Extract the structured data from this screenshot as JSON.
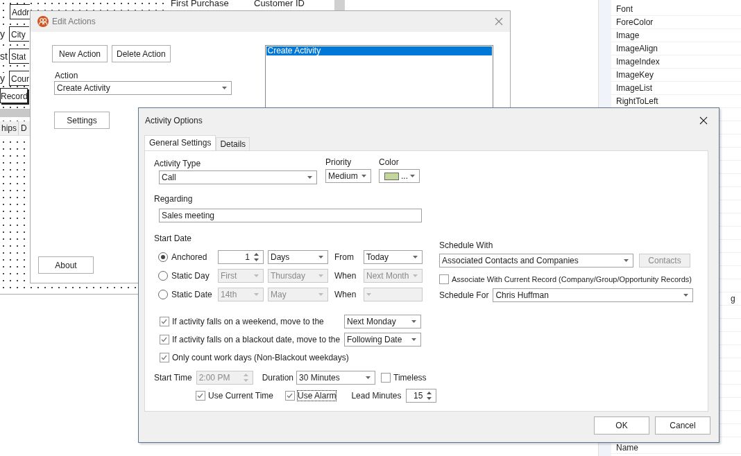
{
  "designer": {
    "fields": [
      {
        "value": "Addr"
      },
      {
        "label": "y",
        "value": "City"
      },
      {
        "label": "st",
        "value": "Stat"
      },
      {
        "label": "y",
        "value": "Cour"
      }
    ],
    "button": "Record",
    "tabs": [
      "hips",
      "D"
    ]
  },
  "grid_header": [
    "First Purchase",
    "Customer ID"
  ],
  "property_grid": {
    "items": [
      "Font",
      "ForeColor",
      "Image",
      "ImageAlign",
      "ImageIndex",
      "ImageKey",
      "ImageList",
      "RightToLeft"
    ],
    "partial_value": "g",
    "bottom_item": "Name"
  },
  "edit_actions": {
    "title": "Edit Actions",
    "buttons": [
      "New Action",
      "Delete Action"
    ],
    "action_label": "Action",
    "action_value": "Create Activity",
    "list": [
      {
        "label": "Create Activity",
        "selected": true
      }
    ],
    "settings_button": "Settings",
    "about_button": "About"
  },
  "activity_options": {
    "title": "Activity Options",
    "tabs": [
      {
        "label": "General Settings",
        "selected": true
      },
      {
        "label": "Details",
        "selected": false
      }
    ],
    "activity_type": {
      "label": "Activity Type",
      "value": "Call"
    },
    "priority": {
      "label": "Priority",
      "value": "Medium"
    },
    "color": {
      "label": "Color",
      "color": "#c4d79b",
      "text": "..."
    },
    "regarding": {
      "label": "Regarding",
      "value": "Sales meeting"
    },
    "start_date": {
      "label": "Start Date",
      "options": [
        {
          "label": "Anchored",
          "selected": true,
          "first": {
            "kind": "spinner",
            "value": "1"
          },
          "second": "Days",
          "link_label": "From",
          "link_value": "Today"
        },
        {
          "label": "Static Day",
          "selected": false,
          "first": {
            "kind": "combo",
            "value": "First"
          },
          "second": "Thursday",
          "link_label": "When",
          "link_value": "Next Month"
        },
        {
          "label": "Static Date",
          "selected": false,
          "first": {
            "kind": "combo",
            "value": "14th"
          },
          "second": "May",
          "link_label": "When"
        }
      ]
    },
    "rules": [
      {
        "label": "If activity falls on a weekend, move to the",
        "checked": true,
        "value": "Next Monday"
      },
      {
        "label": "If activity falls on a blackout date, move to the",
        "checked": true,
        "value": "Following Date"
      },
      {
        "label": "Only count work days (Non-Blackout weekdays)",
        "checked": true
      }
    ],
    "start_time": {
      "label": "Start Time",
      "value": "2:00 PM"
    },
    "duration": {
      "label": "Duration",
      "value": "30 Minutes"
    },
    "timeless": {
      "label": "Timeless",
      "checked": false
    },
    "use_current_time": {
      "label": "Use Current Time",
      "checked": true
    },
    "use_alarm": {
      "label": "Use Alarm",
      "checked": true,
      "focused": true
    },
    "lead_minutes": {
      "label": "Lead Minutes",
      "value": "15"
    },
    "schedule_with": {
      "label": "Schedule With",
      "value": "Associated Contacts and Companies",
      "button": "Contacts",
      "button_disabled": true
    },
    "associate": {
      "label": "Associate With Current Record (Company/Group/Opportunity Records)",
      "checked": false
    },
    "schedule_for": {
      "label": "Schedule For",
      "value": "Chris Huffman"
    },
    "buttons": [
      "OK",
      "Cancel"
    ]
  }
}
